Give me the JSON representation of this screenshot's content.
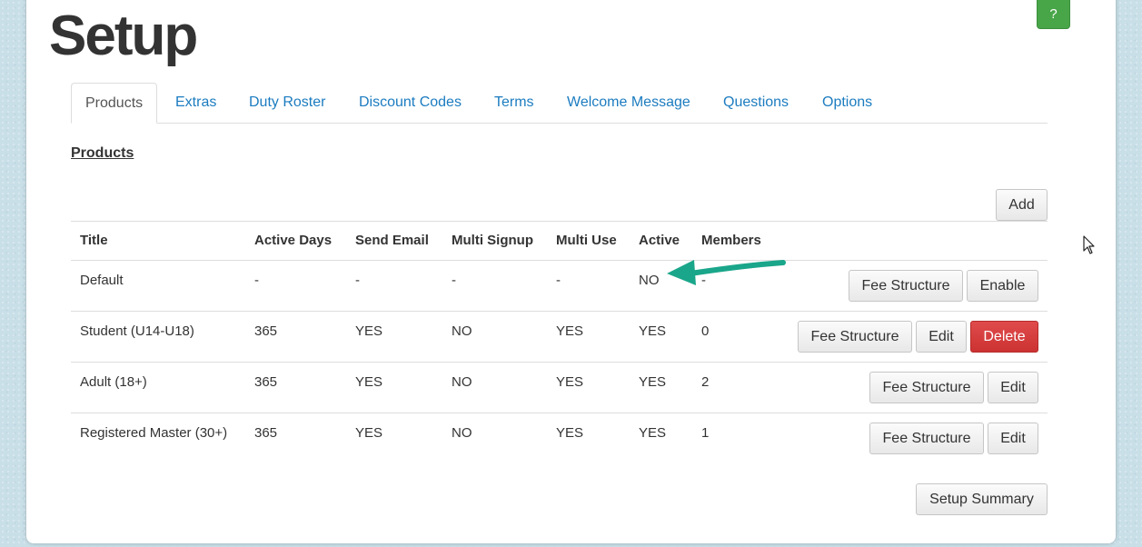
{
  "page": {
    "title": "Setup",
    "help_label": "?"
  },
  "tabs": [
    {
      "label": "Products",
      "active": true
    },
    {
      "label": "Extras"
    },
    {
      "label": "Duty Roster"
    },
    {
      "label": "Discount Codes"
    },
    {
      "label": "Terms"
    },
    {
      "label": "Welcome Message"
    },
    {
      "label": "Questions"
    },
    {
      "label": "Options"
    }
  ],
  "section": {
    "title": "Products",
    "add_label": "Add"
  },
  "table": {
    "headers": [
      "Title",
      "Active Days",
      "Send Email",
      "Multi Signup",
      "Multi Use",
      "Active",
      "Members"
    ],
    "rows": [
      {
        "cells": [
          "Default",
          "-",
          "-",
          "-",
          "-",
          "NO",
          "-"
        ],
        "actions": [
          "Fee Structure",
          "Enable"
        ]
      },
      {
        "cells": [
          "Student (U14-U18)",
          "365",
          "YES",
          "NO",
          "YES",
          "YES",
          "0"
        ],
        "actions": [
          "Fee Structure",
          "Edit",
          "Delete"
        ]
      },
      {
        "cells": [
          "Adult (18+)",
          "365",
          "YES",
          "NO",
          "YES",
          "YES",
          "2"
        ],
        "actions": [
          "Fee Structure",
          "Edit"
        ]
      },
      {
        "cells": [
          "Registered Master (30+)",
          "365",
          "YES",
          "NO",
          "YES",
          "YES",
          "1"
        ],
        "actions": [
          "Fee Structure",
          "Edit"
        ]
      }
    ]
  },
  "footer": {
    "summary_label": "Setup Summary"
  },
  "icons": {
    "help": "question-mark",
    "annotation": "green-arrow-icon",
    "cursor": "mouse-pointer-icon"
  },
  "colors": {
    "accent": "#1c7cc0",
    "help_green": "#48a548",
    "danger": "#d9383a",
    "annotation": "#1aa68a"
  }
}
